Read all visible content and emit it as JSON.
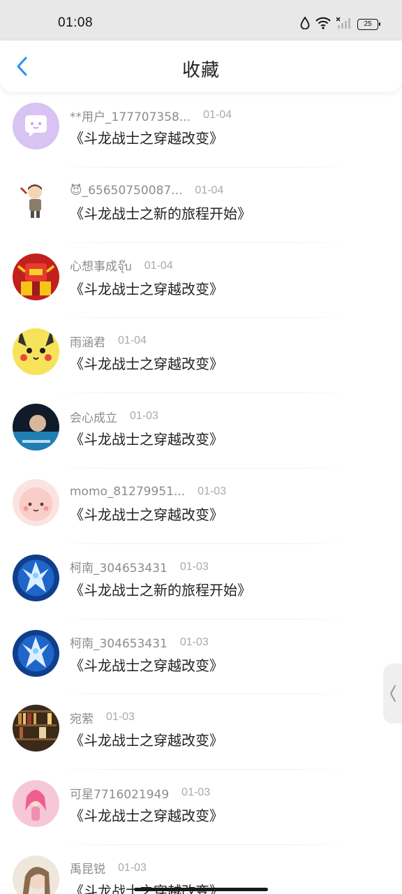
{
  "status_bar": {
    "time": "01:08",
    "battery": "25"
  },
  "header": {
    "title": "收藏"
  },
  "items": [
    {
      "username": "**用户_177707358...",
      "date": "01-04",
      "title": "《斗龙战士之穿越改变》",
      "avatar": "avatar-purple-chat"
    },
    {
      "username": "😈_65650750087...",
      "date": "01-04",
      "title": "《斗龙战士之新的旅程开始》",
      "avatar": "avatar-cartoon-boy"
    },
    {
      "username": "心想事成จุ๊บ",
      "date": "01-04",
      "title": "《斗龙战士之穿越改变》",
      "avatar": "avatar-red-robot"
    },
    {
      "username": "雨涵君",
      "date": "01-04",
      "title": "《斗龙战士之穿越改变》",
      "avatar": "avatar-pikachu"
    },
    {
      "username": "会心成立",
      "date": "01-03",
      "title": "《斗龙战士之穿越改变》",
      "avatar": "avatar-dark-portrait"
    },
    {
      "username": "momo_81279951...",
      "date": "01-03",
      "title": "《斗龙战士之穿越改变》",
      "avatar": "avatar-pink-character"
    },
    {
      "username": "柯南_304653431",
      "date": "01-03",
      "title": "《斗龙战士之新的旅程开始》",
      "avatar": "avatar-blue-warrior"
    },
    {
      "username": "柯南_304653431",
      "date": "01-03",
      "title": "《斗龙战士之穿越改变》",
      "avatar": "avatar-blue-warrior"
    },
    {
      "username": "宛萦",
      "date": "01-03",
      "title": "《斗龙战士之穿越改变》",
      "avatar": "avatar-bookshelf"
    },
    {
      "username": "可星7716021949",
      "date": "01-03",
      "title": "《斗龙战士之穿越改变》",
      "avatar": "avatar-pink-anime"
    },
    {
      "username": "禹昆锐",
      "date": "01-03",
      "title": "《斗龙战士之穿越改变》",
      "avatar": "avatar-girl-portrait"
    }
  ],
  "icons": {
    "back": "chevron-left-icon",
    "side_handle": "chevron-left-icon",
    "accent": "#2b8ff0"
  }
}
